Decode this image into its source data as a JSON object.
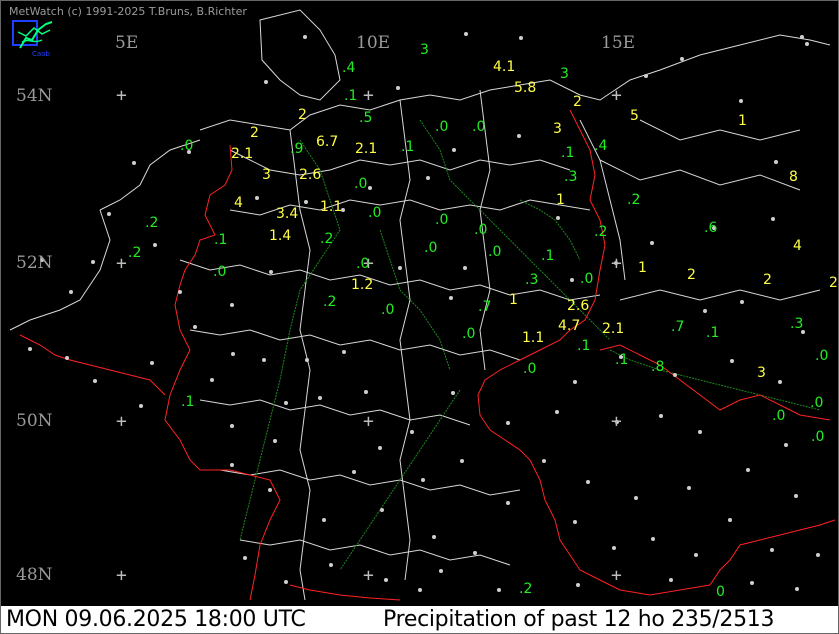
{
  "header": {
    "copyright": "MetWatch  (c) 1991-2025 T.Bruns, B.Richter"
  },
  "logo": {
    "icon": "metwatch-logo-icon",
    "label": "Caob"
  },
  "grid": {
    "longitudes": [
      "5E",
      "10E",
      "15E"
    ],
    "latitudes": [
      "54N",
      "52N",
      "50N",
      "48N"
    ]
  },
  "colors": {
    "background": "#000000",
    "borders": "#ff2222",
    "rivers": "#1f8a1f",
    "regions": "#d8d8d8",
    "value_yellow": "#ffff44",
    "value_green": "#22ee22",
    "station_dot": "#cfcfcf"
  },
  "observations": {
    "yellow": [
      "4.1",
      "5.8",
      "2",
      "3",
      "5",
      "1",
      "2",
      "2",
      "6.7",
      "2.1",
      "2.1",
      "3",
      "2.6",
      "8",
      "4",
      "3.4",
      "1.1",
      "1",
      "1.4",
      "4",
      "1",
      "2",
      "2",
      "2",
      "1.2",
      "2.6",
      "1",
      "4.7",
      "2.1",
      "1.1",
      "3"
    ],
    "green": [
      "3",
      "3",
      ".4",
      ".1",
      ".5",
      ".1",
      ".0",
      ".0",
      ".0",
      ".9",
      ".1",
      ".4",
      ".0",
      ".3",
      ".2",
      ".0",
      ".0",
      ".2",
      ".0",
      ".0",
      ".0",
      ".2",
      ".2",
      ".1",
      ".2",
      ".0",
      ".6",
      ".1",
      ".3",
      ".0",
      ".0",
      ".2",
      ".0",
      ".7",
      ".0",
      ".7",
      ".1",
      ".1",
      ".8",
      ".3",
      ".0",
      ".1",
      ".0",
      ".0",
      ".0",
      ".1",
      ".0",
      ".2",
      "0"
    ]
  },
  "footer": {
    "datetime": "MON 09.06.2025 18:00 UTC",
    "product": "Precipitation of past  12 ho 235/2513"
  }
}
